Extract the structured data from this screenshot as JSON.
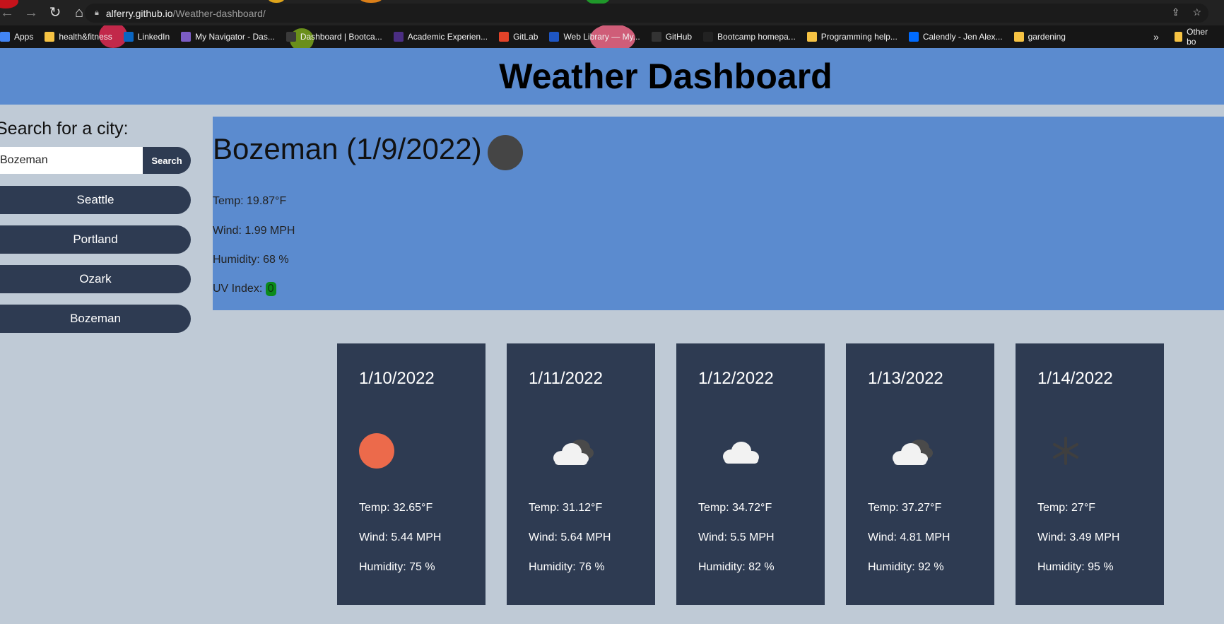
{
  "browser": {
    "url_host": "alferry.github.io",
    "url_path": "/Weather-dashboard/",
    "bookmarks": [
      {
        "label": "Apps",
        "color": "#4285f4"
      },
      {
        "label": "health&fitness",
        "color": "#f6c343"
      },
      {
        "label": "LinkedIn",
        "color": "#0a66c2"
      },
      {
        "label": "My Navigator - Das...",
        "color": "#7b5cc4"
      },
      {
        "label": "Dashboard | Bootca...",
        "color": "#3a3a3a"
      },
      {
        "label": "Academic Experien...",
        "color": "#4b2e83"
      },
      {
        "label": "GitLab",
        "color": "#e24329"
      },
      {
        "label": "Web Library — My...",
        "color": "#1e56c4"
      },
      {
        "label": "GitHub",
        "color": "#333333"
      },
      {
        "label": "Bootcamp homepa...",
        "color": "#222222"
      },
      {
        "label": "Programming help...",
        "color": "#f6c343"
      },
      {
        "label": "Calendly - Jen Alex...",
        "color": "#006bff"
      },
      {
        "label": "gardening",
        "color": "#f6c343"
      }
    ],
    "more_label": "»",
    "other_bookmarks": "Other bo"
  },
  "header": {
    "title": "Weather Dashboard"
  },
  "search": {
    "label": "Search for a city:",
    "value": "Bozeman",
    "button": "Search"
  },
  "history": [
    "Seattle",
    "Portland",
    "Ozark",
    "Bozeman"
  ],
  "current": {
    "title": "Bozeman (1/9/2022)",
    "temp": "Temp: 19.87°F",
    "wind": "Wind: 1.99 MPH",
    "humidity": "Humidity: 68 %",
    "uv_label": "UV Index: ",
    "uv_value": "0",
    "icon": "moon-icon"
  },
  "forecast": [
    {
      "date": "1/10/2022",
      "icon": "sun-icon",
      "temp": "Temp: 32.65°F",
      "wind": "Wind: 5.44 MPH",
      "humidity": "Humidity: 75 %"
    },
    {
      "date": "1/11/2022",
      "icon": "cloud-moon-icon",
      "temp": "Temp: 31.12°F",
      "wind": "Wind: 5.64 MPH",
      "humidity": "Humidity: 76 %"
    },
    {
      "date": "1/12/2022",
      "icon": "cloud-icon",
      "temp": "Temp: 34.72°F",
      "wind": "Wind: 5.5 MPH",
      "humidity": "Humidity: 82 %"
    },
    {
      "date": "1/13/2022",
      "icon": "cloud-moon-icon",
      "temp": "Temp: 37.27°F",
      "wind": "Wind: 4.81 MPH",
      "humidity": "Humidity: 92 %"
    },
    {
      "date": "1/14/2022",
      "icon": "snowflake-icon",
      "temp": "Temp: 27°F",
      "wind": "Wind: 3.49 MPH",
      "humidity": "Humidity: 95 %"
    }
  ],
  "colors": {
    "header_bg": "#5b8bcf",
    "page_bg": "#bfcad6",
    "card_bg": "#2e3b52",
    "uv_badge": "#0b8a1b"
  }
}
